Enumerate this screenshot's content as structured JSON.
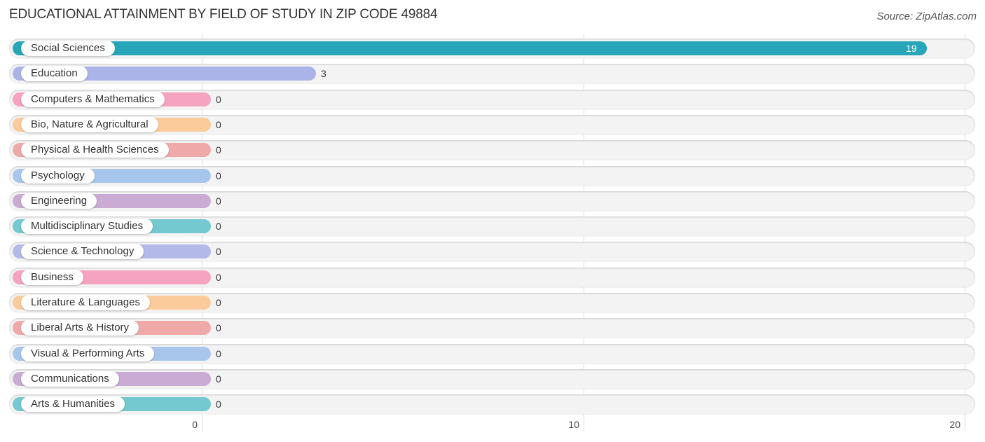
{
  "chart_data": {
    "type": "bar",
    "orientation": "horizontal",
    "title": "EDUCATIONAL ATTAINMENT BY FIELD OF STUDY IN ZIP CODE 49884",
    "source": "Source: ZipAtlas.com",
    "xlabel": "",
    "ylabel": "",
    "xlim": [
      0,
      20
    ],
    "xticks": [
      "0",
      "10",
      "20"
    ],
    "grid": true,
    "categories": [
      "Social Sciences",
      "Education",
      "Computers & Mathematics",
      "Bio, Nature & Agricultural",
      "Physical & Health Sciences",
      "Psychology",
      "Engineering",
      "Multidisciplinary Studies",
      "Science & Technology",
      "Business",
      "Literature & Languages",
      "Liberal Arts & History",
      "Visual & Performing Arts",
      "Communications",
      "Arts & Humanities"
    ],
    "values": [
      19,
      3,
      0,
      0,
      0,
      0,
      0,
      0,
      0,
      0,
      0,
      0,
      0,
      0,
      0
    ],
    "value_labels": [
      "19",
      "3",
      "0",
      "0",
      "0",
      "0",
      "0",
      "0",
      "0",
      "0",
      "0",
      "0",
      "0",
      "0",
      "0"
    ],
    "colors": [
      "#26a6b8",
      "#aab4e8",
      "#f5a3c0",
      "#fccb9c",
      "#f0a9a9",
      "#a8c6ec",
      "#c9abd3",
      "#74c8d0",
      "#b3baea",
      "#f5a3c0",
      "#fccb9c",
      "#f0a9a9",
      "#a8c6ec",
      "#c9abd3",
      "#74c8d0"
    ]
  }
}
